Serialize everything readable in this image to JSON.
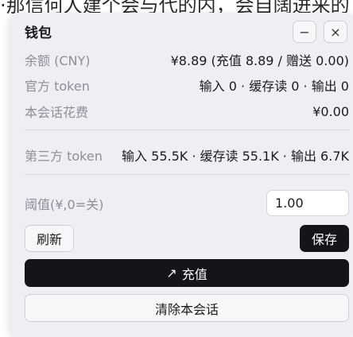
{
  "background": {
    "text": "·那信何人建个会与代的内，会自阔进来的"
  },
  "wallet": {
    "title": "钱包",
    "minimize_label": "−",
    "close_label": "×",
    "balance": {
      "label": "余额 (CNY)",
      "value": "¥8.89 (充值 8.89 / 赠送 0.00)"
    },
    "official_token": {
      "label": "官方 token",
      "value": "输入 0 · 缓存读 0 · 输出 0"
    },
    "session_cost": {
      "label": "本会话花费",
      "value": "¥0.00"
    },
    "third_party_token": {
      "label": "第三方 token",
      "value": "输入 55.5K · 缓存读 55.1K · 输出 6.7K"
    },
    "threshold": {
      "label": "阈值(¥,0=关)",
      "value": "1.00"
    },
    "refresh_label": "刷新",
    "save_label": "保存",
    "topup_icon": "↗",
    "topup_label": "充值",
    "clear_label": "清除本会话"
  },
  "colors": {
    "panel_bg": "#eeeff3",
    "primary_button": "#141419",
    "label_gray": "#8d8f99"
  }
}
